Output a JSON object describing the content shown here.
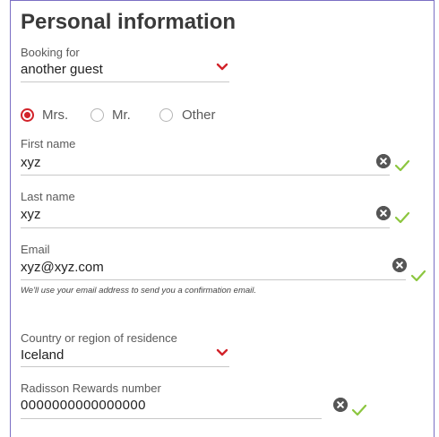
{
  "section_title": "Personal information",
  "booking_for": {
    "label": "Booking for",
    "value": "another guest"
  },
  "salutation": {
    "options": [
      "Mrs.",
      "Mr.",
      "Other"
    ],
    "selected": "Mrs."
  },
  "first_name": {
    "label": "First name",
    "value": "xyz"
  },
  "last_name": {
    "label": "Last name",
    "value": "xyz"
  },
  "email": {
    "label": "Email",
    "value": "xyz@xyz.com",
    "hint": "We'll use your email address to send you a confirmation email."
  },
  "country": {
    "label": "Country or region of residence",
    "value": "Iceland"
  },
  "rewards": {
    "label": "Radisson Rewards number",
    "value": "0000000000000000"
  },
  "colors": {
    "accent_red": "#d2232a",
    "valid_green": "#8cc63f",
    "clear_gray": "#555555",
    "frame_purple": "#7b6fc4"
  },
  "icons": {
    "dropdown": "chevron-down-icon",
    "clear": "clear-icon",
    "valid": "check-icon"
  }
}
